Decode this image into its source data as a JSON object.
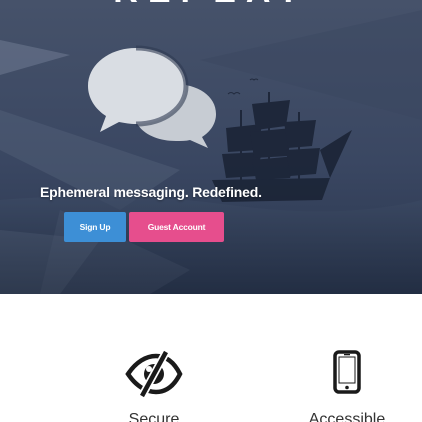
{
  "hero": {
    "title": "REPEAT",
    "logo_icon": "speech-bubbles-icon",
    "tagline": "Ephemeral messaging. Redefined.",
    "signup_label": "Sign Up",
    "guest_label": "Guest Account",
    "colors": {
      "signup": "#3d8fd6",
      "guest": "#e64e8d",
      "overlay": "#2c3a54"
    }
  },
  "features": [
    {
      "label": "Secure",
      "icon": "eye-slash-icon"
    },
    {
      "label": "Accessible",
      "icon": "mobile-phone-icon"
    }
  ]
}
